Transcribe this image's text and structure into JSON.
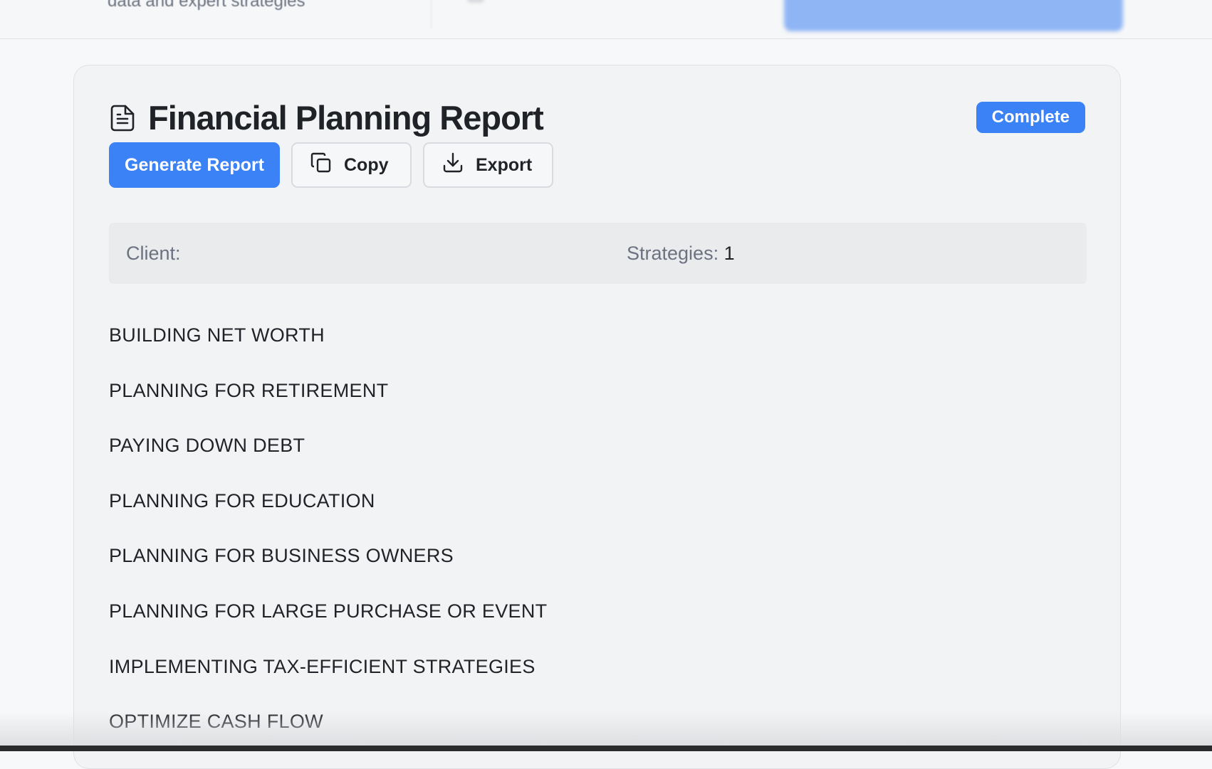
{
  "header_strip": {
    "subtitle": "data and expert strategies"
  },
  "report": {
    "title": "Financial Planning Report",
    "status_badge": "Complete",
    "actions": {
      "generate_label": "Generate Report",
      "copy_label": "Copy",
      "export_label": "Export"
    },
    "info": {
      "client_label": "Client:",
      "client_value": "",
      "strategies_label": "Strategies:",
      "strategies_count": "1"
    },
    "sections": [
      "BUILDING NET WORTH",
      "PLANNING FOR RETIREMENT",
      "PAYING DOWN DEBT",
      "PLANNING FOR EDUCATION",
      "PLANNING FOR BUSINESS OWNERS",
      "PLANNING FOR LARGE PURCHASE OR EVENT",
      "IMPLEMENTING TAX-EFFICIENT STRATEGIES",
      "OPTIMIZE CASH FLOW"
    ]
  },
  "icons": {
    "title_icon": "document-icon",
    "copy_icon": "copy-icon",
    "export_icon": "download-icon"
  },
  "colors": {
    "accent": "#3b82f6",
    "card_background": "#f2f3f5",
    "info_bar_background": "#eaebed",
    "muted_text": "#6b7280"
  }
}
